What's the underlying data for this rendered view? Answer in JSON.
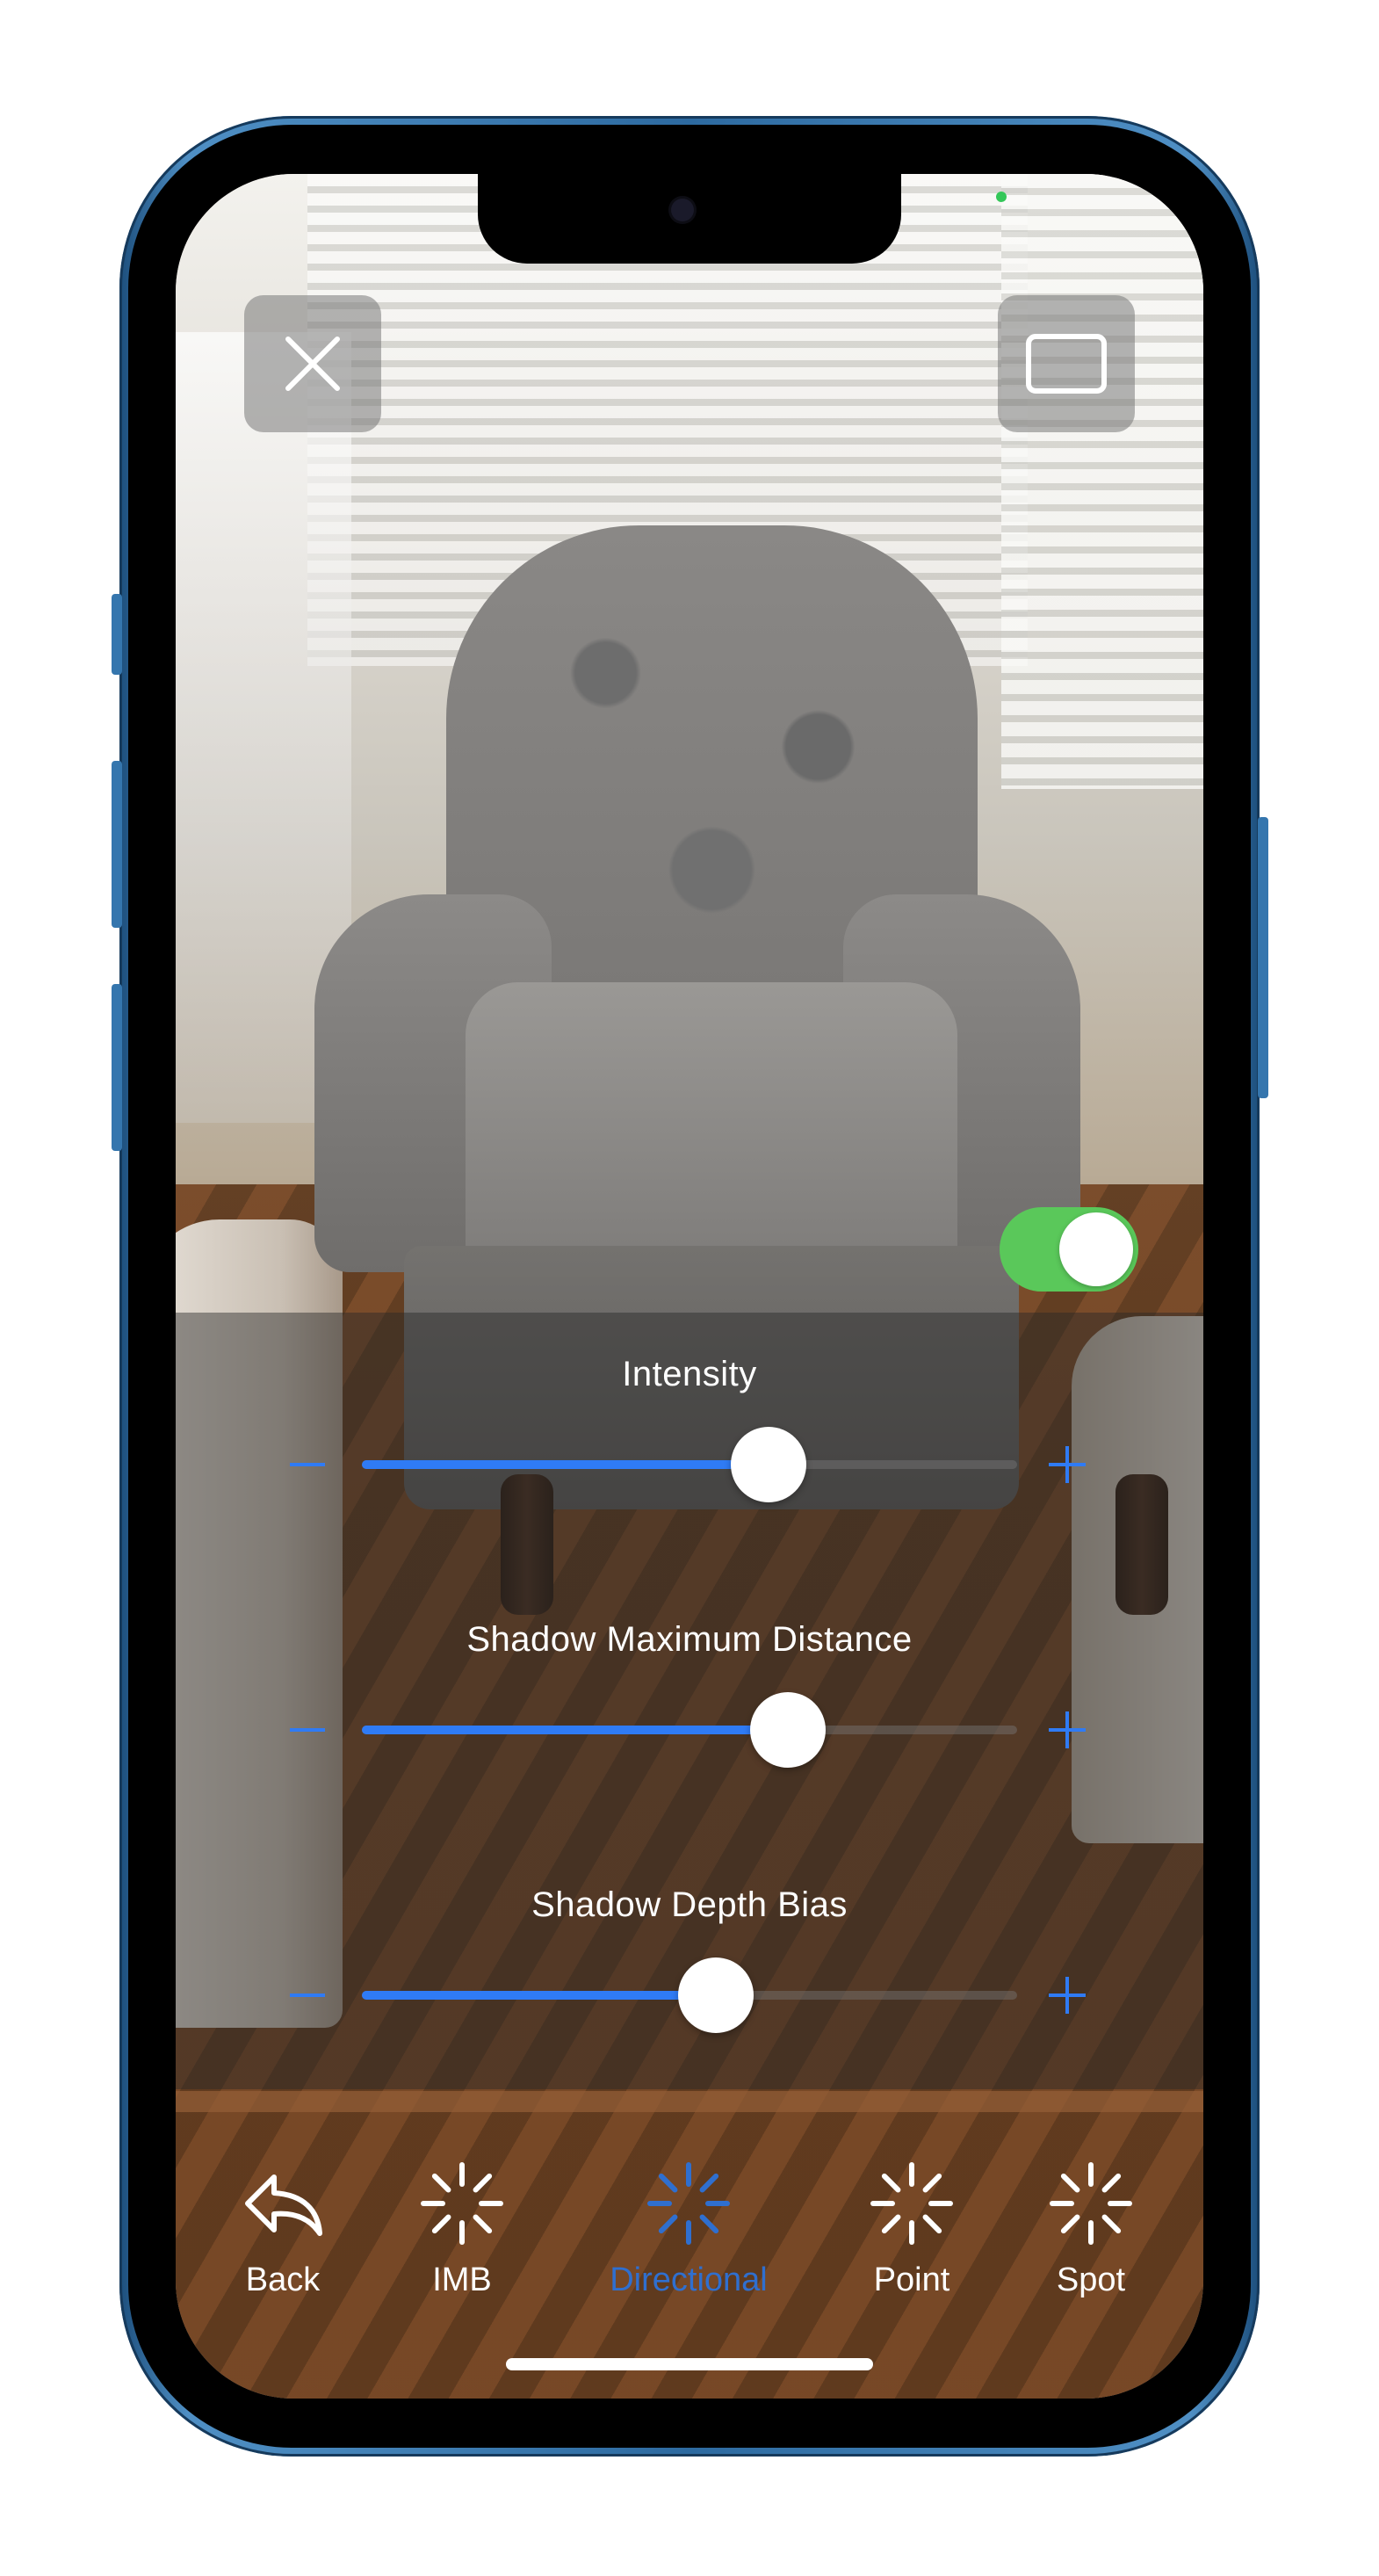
{
  "colors": {
    "accent": "#2f7bf5",
    "toggle_on": "#5ac85a",
    "active_tab": "#2f6fcf",
    "frame": "#2d6aa0"
  },
  "top_bar": {
    "close_icon": "close-icon",
    "fullscreen_icon": "rectangle-icon"
  },
  "toggle": {
    "state": "on"
  },
  "settings": {
    "sliders": [
      {
        "label": "Intensity",
        "value_fraction": 0.62
      },
      {
        "label": "Shadow Maximum Distance",
        "value_fraction": 0.65
      },
      {
        "label": "Shadow Depth Bias",
        "value_fraction": 0.54
      }
    ]
  },
  "tabs": [
    {
      "label": "Back",
      "icon": "back-arrow-icon",
      "active": false
    },
    {
      "label": "IMB",
      "icon": "sparkle-icon",
      "active": false
    },
    {
      "label": "Directional",
      "icon": "sparkle-icon",
      "active": true
    },
    {
      "label": "Point",
      "icon": "sparkle-icon",
      "active": false
    },
    {
      "label": "Spot",
      "icon": "sparkle-icon",
      "active": false
    }
  ]
}
